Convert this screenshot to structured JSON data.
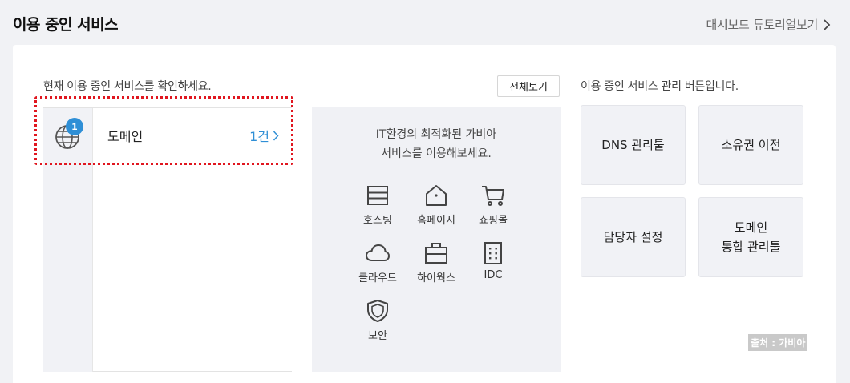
{
  "header": {
    "title": "이용 중인 서비스",
    "tutorial_link": "대시보드 튜토리얼보기"
  },
  "services": {
    "intro": "현재 이용 중인 서비스를 확인하세요.",
    "view_all": "전체보기",
    "items": [
      {
        "name": "도메인",
        "count": "1건",
        "badge": "1",
        "icon": "globe-icon"
      }
    ]
  },
  "promo": {
    "line1": "IT환경의 최적화된 가비아",
    "line2": "서비스를 이용해보세요.",
    "items": [
      {
        "label": "호스팅",
        "icon": "hosting-icon"
      },
      {
        "label": "홈페이지",
        "icon": "home-icon"
      },
      {
        "label": "쇼핑몰",
        "icon": "cart-icon"
      },
      {
        "label": "클라우드",
        "icon": "cloud-icon"
      },
      {
        "label": "하이웍스",
        "icon": "briefcase-icon"
      },
      {
        "label": "IDC",
        "icon": "server-icon"
      },
      {
        "label": "보안",
        "icon": "shield-icon"
      }
    ]
  },
  "manage": {
    "intro": "이용 중인 서비스 관리 버튼입니다.",
    "buttons": [
      {
        "line1": "DNS 관리툴",
        "line2": ""
      },
      {
        "line1": "소유권 이전",
        "line2": ""
      },
      {
        "line1": "담당자 설정",
        "line2": ""
      },
      {
        "line1": "도메인",
        "line2": "통합 관리툴"
      }
    ]
  },
  "source_tag": "출처 : 가비아",
  "colors": {
    "accent": "#2f8fd6",
    "highlight": "#e0161f",
    "panel": "#f1f2f6"
  }
}
